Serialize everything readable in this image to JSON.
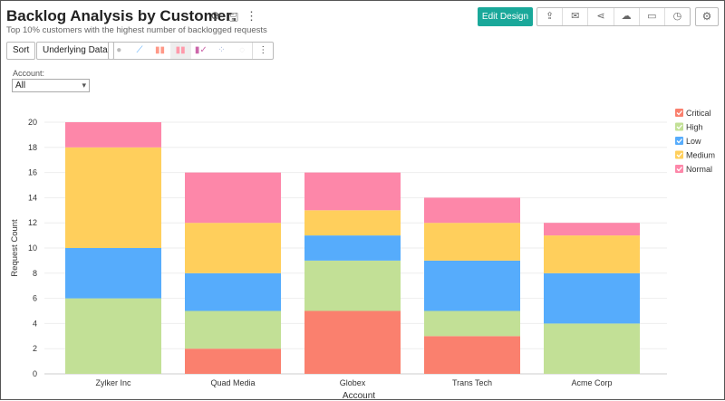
{
  "header": {
    "title": "Backlog Analysis by Customer",
    "subtitle": "Top 10% customers with the highest number of backlogged requests",
    "icons": [
      "refresh-icon",
      "save-icon",
      "more-icon"
    ]
  },
  "toolbar": {
    "sort_label": "Sort",
    "underlying_label": "Underlying Data",
    "chart_types": [
      "pie",
      "line",
      "bar",
      "stacked-bar",
      "combo",
      "scatter",
      "map"
    ],
    "selected_chart_type": "stacked-bar",
    "edit_label": "Edit Design",
    "actions": [
      "export-icon",
      "email-icon",
      "share-icon",
      "publish-icon",
      "comment-icon",
      "schedule-icon"
    ],
    "settings": "gear-icon"
  },
  "filter": {
    "label": "Account:",
    "value": "All"
  },
  "chart_data": {
    "type": "bar",
    "stacked": true,
    "xlabel": "Account",
    "ylabel": "Request Count",
    "ylim": [
      0,
      20
    ],
    "yticks": [
      0,
      2,
      4,
      6,
      8,
      10,
      12,
      14,
      16,
      18,
      20
    ],
    "grid": true,
    "legend_position": "right",
    "categories": [
      "Zylker Inc",
      "Quad Media",
      "Globex",
      "Trans Tech",
      "Acme Corp"
    ],
    "series": [
      {
        "name": "Critical",
        "color": "#fa806e",
        "values": [
          0,
          2,
          5,
          3,
          0
        ]
      },
      {
        "name": "High",
        "color": "#c2e096",
        "values": [
          6,
          3,
          4,
          2,
          4
        ]
      },
      {
        "name": "Low",
        "color": "#56acfc",
        "values": [
          4,
          3,
          2,
          4,
          4
        ]
      },
      {
        "name": "Medium",
        "color": "#ffcf5c",
        "values": [
          8,
          4,
          2,
          3,
          3
        ]
      },
      {
        "name": "Normal",
        "color": "#fd87a9",
        "values": [
          2,
          4,
          3,
          2,
          1
        ]
      }
    ]
  }
}
